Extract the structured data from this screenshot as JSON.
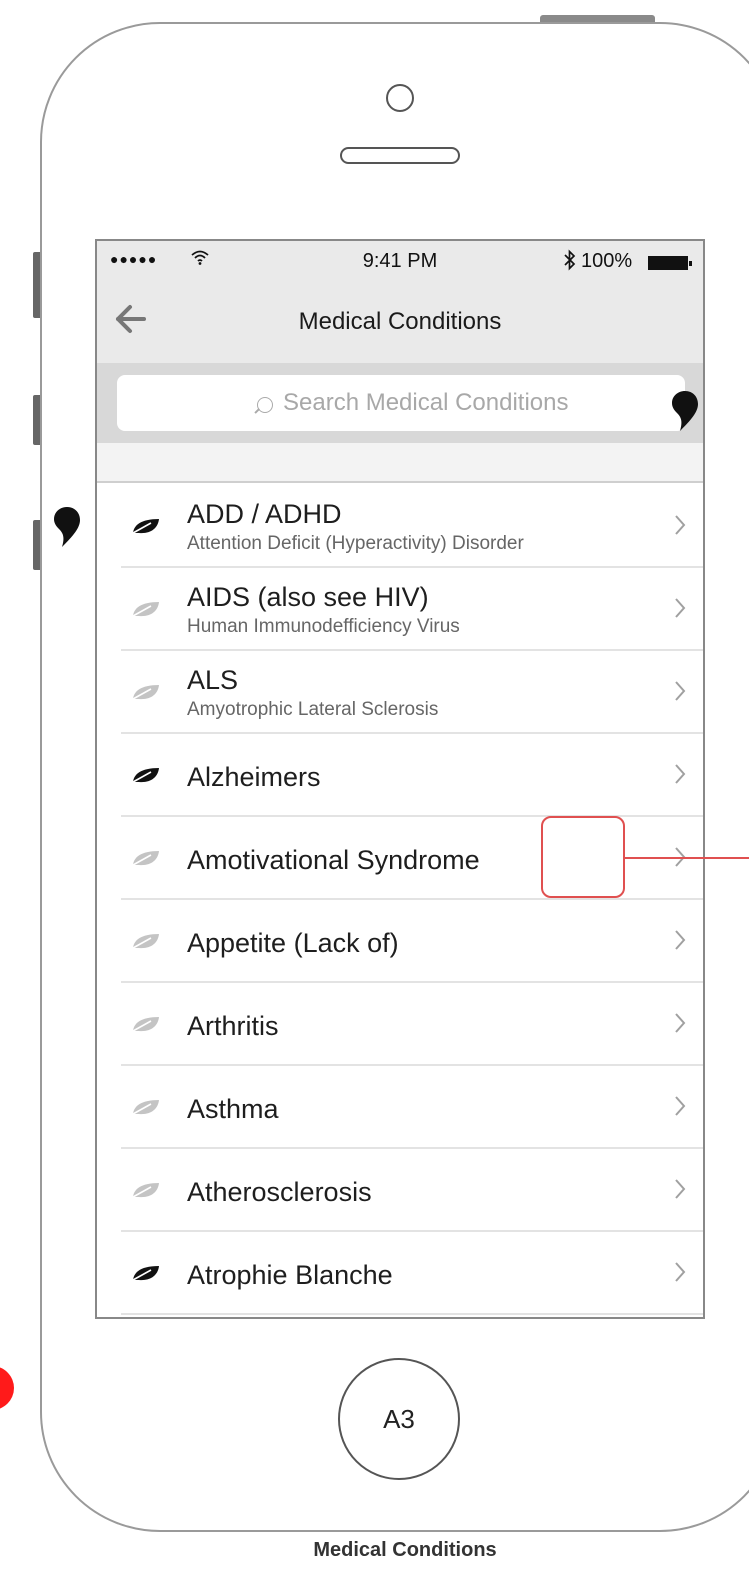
{
  "status_bar": {
    "signal": "●●●●●",
    "wifi_icon": "wifi-icon",
    "time": "9:41 PM",
    "bluetooth_icon": "bluetooth-icon",
    "battery": "100%"
  },
  "nav": {
    "back_icon": "arrow-left-icon",
    "title": "Medical Conditions"
  },
  "search": {
    "placeholder": "Search Medical Conditions",
    "value": ""
  },
  "conditions": [
    {
      "name": "ADD / ADHD",
      "subtitle": "Attention Deficit (Hyperactivity) Disorder",
      "leaf": "dark"
    },
    {
      "name": "AIDS (also see HIV)",
      "subtitle": "Human Immunodefficiency Virus",
      "leaf": "light"
    },
    {
      "name": "ALS",
      "subtitle": "Amyotrophic Lateral Sclerosis",
      "leaf": "light"
    },
    {
      "name": "Alzheimers",
      "subtitle": "",
      "leaf": "dark"
    },
    {
      "name": "Amotivational Syndrome",
      "subtitle": "",
      "leaf": "light"
    },
    {
      "name": "Appetite (Lack of)",
      "subtitle": "",
      "leaf": "light"
    },
    {
      "name": "Arthritis",
      "subtitle": "",
      "leaf": "light"
    },
    {
      "name": "Asthma",
      "subtitle": "",
      "leaf": "light"
    },
    {
      "name": "Atherosclerosis",
      "subtitle": "",
      "leaf": "light"
    },
    {
      "name": "Atrophie Blanche",
      "subtitle": "",
      "leaf": "dark"
    }
  ],
  "home_button": "A3",
  "caption": "Medical Conditions",
  "colors": {
    "leaf_dark": "#111111",
    "leaf_light": "#c4c4c4",
    "annotation_red": "#e05050",
    "dot_red": "#ff1a1a"
  }
}
